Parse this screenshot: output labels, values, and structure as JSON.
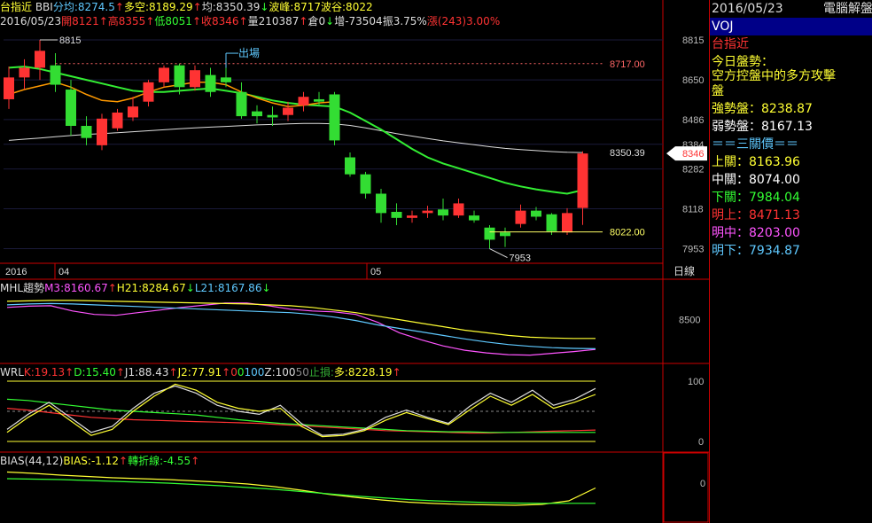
{
  "header": {
    "symbol": "台指近",
    "date": "2016/05/23",
    "stats": [
      {
        "text": "BBI",
        "color": "#dddddd"
      },
      {
        "text": "分均:8274.5",
        "color": "#5fc9ff"
      },
      {
        "text": "↑",
        "color": "#ff3333"
      },
      {
        "text": "多空:8189.29",
        "color": "#ffff33"
      },
      {
        "text": "↑",
        "color": "#ff3333"
      },
      {
        "text": "均:8350.39",
        "color": "#dddddd"
      },
      {
        "text": "↓",
        "color": "#33ff33"
      },
      {
        "text": "波峰:8717",
        "color": "#ffff33"
      },
      {
        "text": "波谷:8022",
        "color": "#ffff33"
      }
    ],
    "ohlc": [
      {
        "text": "2016/05/23",
        "color": "#dddddd"
      },
      {
        "text": "開8121",
        "color": "#ff3333"
      },
      {
        "text": "↑",
        "color": "#ff3333"
      },
      {
        "text": "高8355",
        "color": "#ff3333"
      },
      {
        "text": "↑",
        "color": "#ff3333"
      },
      {
        "text": "低8051",
        "color": "#33ff33"
      },
      {
        "text": "↑",
        "color": "#ff3333"
      },
      {
        "text": "收8346",
        "color": "#ff3333"
      },
      {
        "text": "↑",
        "color": "#ff3333"
      },
      {
        "text": "量210387",
        "color": "#dddddd"
      },
      {
        "text": "↑",
        "color": "#ff3333"
      },
      {
        "text": "倉0",
        "color": "#dddddd"
      },
      {
        "text": "↓",
        "color": "#33ff33"
      },
      {
        "text": "增-73504",
        "color": "#dddddd"
      },
      {
        "text": "振3.75%",
        "color": "#dddddd"
      },
      {
        "text": "漲(243)3.00%",
        "color": "#ff3333"
      }
    ]
  },
  "side_panel": {
    "date": "2016/05/23",
    "title": "電腦解盤",
    "code": "VOJ",
    "name": "台指近",
    "trend_label": "今日盤勢：",
    "trend_line1": "空方控盤中的多方攻擊",
    "trend_line2": "盤",
    "strong": "強勢盤：8238.87",
    "weak": "弱勢盤：8167.13",
    "three_title": "＝＝三關價＝＝",
    "up": "上關：8163.96",
    "mid": "中關：8074.00",
    "down": "下關：7984.04",
    "next_up": "明上：8471.13",
    "next_mid": "明中：8203.00",
    "next_down": "明下：7934.87"
  },
  "chart_data": [
    {
      "type": "candlestick",
      "ylim": [
        7900,
        8870
      ],
      "y_ticks": [
        "8815",
        "8650",
        "8486",
        "8384",
        "8282",
        "8118",
        "7953"
      ],
      "current_price_tag": "8346",
      "annotations": {
        "peak": "8815",
        "trough": "7953",
        "exit": "出場",
        "wave_peak": "8717.00",
        "wave_trough": "8022.00",
        "avg": "8350.39"
      },
      "x_labels": [
        "2016",
        "04",
        "05"
      ],
      "period": "日線",
      "candles": [
        {
          "o": 8570,
          "h": 8705,
          "l": 8530,
          "c": 8660
        },
        {
          "o": 8660,
          "h": 8735,
          "l": 8610,
          "c": 8700
        },
        {
          "o": 8700,
          "h": 8815,
          "l": 8650,
          "c": 8770
        },
        {
          "o": 8710,
          "h": 8760,
          "l": 8600,
          "c": 8630
        },
        {
          "o": 8610,
          "h": 8650,
          "l": 8420,
          "c": 8460
        },
        {
          "o": 8460,
          "h": 8500,
          "l": 8380,
          "c": 8410
        },
        {
          "o": 8380,
          "h": 8510,
          "l": 8360,
          "c": 8490
        },
        {
          "o": 8450,
          "h": 8530,
          "l": 8440,
          "c": 8515
        },
        {
          "o": 8495,
          "h": 8580,
          "l": 8480,
          "c": 8540
        },
        {
          "o": 8560,
          "h": 8650,
          "l": 8540,
          "c": 8640
        },
        {
          "o": 8640,
          "h": 8710,
          "l": 8620,
          "c": 8700
        },
        {
          "o": 8710,
          "h": 8717,
          "l": 8590,
          "c": 8620
        },
        {
          "o": 8620,
          "h": 8710,
          "l": 8605,
          "c": 8690
        },
        {
          "o": 8670,
          "h": 8700,
          "l": 8580,
          "c": 8600
        },
        {
          "o": 8660,
          "h": 8710,
          "l": 8620,
          "c": 8640
        },
        {
          "o": 8600,
          "h": 8640,
          "l": 8490,
          "c": 8500
        },
        {
          "o": 8520,
          "h": 8545,
          "l": 8470,
          "c": 8500
        },
        {
          "o": 8505,
          "h": 8540,
          "l": 8460,
          "c": 8495
        },
        {
          "o": 8505,
          "h": 8560,
          "l": 8480,
          "c": 8535
        },
        {
          "o": 8545,
          "h": 8600,
          "l": 8520,
          "c": 8580
        },
        {
          "o": 8570,
          "h": 8600,
          "l": 8540,
          "c": 8560
        },
        {
          "o": 8590,
          "h": 8600,
          "l": 8380,
          "c": 8400
        },
        {
          "o": 8330,
          "h": 8350,
          "l": 8250,
          "c": 8260
        },
        {
          "o": 8260,
          "h": 8270,
          "l": 8160,
          "c": 8180
        },
        {
          "o": 8180,
          "h": 8200,
          "l": 8060,
          "c": 8100
        },
        {
          "o": 8105,
          "h": 8140,
          "l": 8050,
          "c": 8080
        },
        {
          "o": 8080,
          "h": 8110,
          "l": 8060,
          "c": 8090
        },
        {
          "o": 8100,
          "h": 8130,
          "l": 8080,
          "c": 8110
        },
        {
          "o": 8115,
          "h": 8160,
          "l": 8070,
          "c": 8090
        },
        {
          "o": 8090,
          "h": 8160,
          "l": 8080,
          "c": 8140
        },
        {
          "o": 8090,
          "h": 8110,
          "l": 8060,
          "c": 8070
        },
        {
          "o": 8040,
          "h": 8050,
          "l": 7953,
          "c": 7990
        },
        {
          "o": 8020,
          "h": 8040,
          "l": 7960,
          "c": 8005
        },
        {
          "o": 8055,
          "h": 8135,
          "l": 8040,
          "c": 8110
        },
        {
          "o": 8110,
          "h": 8125,
          "l": 8070,
          "c": 8085
        },
        {
          "o": 8095,
          "h": 8100,
          "l": 8010,
          "c": 8025
        },
        {
          "o": 8020,
          "h": 8120,
          "l": 8010,
          "c": 8100
        },
        {
          "o": 8121,
          "h": 8355,
          "l": 8051,
          "c": 8346
        }
      ],
      "ma_short_color": "#ff9900",
      "ma_short": [
        8590,
        8610,
        8625,
        8640,
        8620,
        8590,
        8565,
        8560,
        8575,
        8600,
        8620,
        8630,
        8640,
        8640,
        8630,
        8600,
        8575,
        8555,
        8540,
        8545,
        8555,
        8560
      ],
      "ma_mid_color": "#33ee33",
      "ma_mid": [
        8700,
        8705,
        8695,
        8680,
        8665,
        8650,
        8635,
        8620,
        8605,
        8600,
        8600,
        8605,
        8610,
        8615,
        8605,
        8595,
        8580,
        8565,
        8555,
        8548,
        8544,
        8540,
        8515,
        8480,
        8445,
        8405,
        8365,
        8330,
        8305,
        8285,
        8265,
        8245,
        8225,
        8210,
        8198,
        8188,
        8180,
        8195
      ],
      "ma_long_color": "#dddddd",
      "ma_long": [
        8400,
        8405,
        8410,
        8415,
        8420,
        8425,
        8428,
        8432,
        8436,
        8440,
        8444,
        8448,
        8452,
        8455,
        8458,
        8461,
        8464,
        8466,
        8468,
        8470,
        8470,
        8468,
        8462,
        8452,
        8440,
        8428,
        8418,
        8408,
        8398,
        8390,
        8382,
        8374,
        8367,
        8362,
        8358,
        8354,
        8351,
        8350
      ]
    },
    {
      "type": "line",
      "name": "MHL趨勢",
      "labels": [
        {
          "text": "MHL趨勢",
          "color": "#dddddd"
        },
        {
          "text": "M3:8160.67",
          "color": "#ff55ff"
        },
        {
          "text": "↑",
          "color": "#ff3333"
        },
        {
          "text": "H21:8284.67",
          "color": "#ffff33"
        },
        {
          "text": "↓",
          "color": "#33ff33"
        },
        {
          "text": "L21:8167.86",
          "color": "#5fc9ff"
        },
        {
          "text": "↓",
          "color": "#33ff33"
        }
      ],
      "y_tick": "8500",
      "ylim": [
        8050,
        8760
      ],
      "series": [
        {
          "color": "#ff55ff",
          "values": [
            8640,
            8655,
            8660,
            8600,
            8560,
            8550,
            8580,
            8610,
            8640,
            8665,
            8690,
            8690,
            8660,
            8620,
            8600,
            8590,
            8560,
            8470,
            8350,
            8270,
            8200,
            8150,
            8120,
            8100,
            8095,
            8115,
            8135,
            8160
          ]
        },
        {
          "color": "#ffff33",
          "values": [
            8710,
            8715,
            8720,
            8720,
            8715,
            8710,
            8705,
            8700,
            8695,
            8690,
            8685,
            8680,
            8670,
            8660,
            8640,
            8610,
            8580,
            8540,
            8500,
            8460,
            8420,
            8380,
            8350,
            8320,
            8300,
            8290,
            8285,
            8285
          ]
        },
        {
          "color": "#5fc9ff",
          "values": [
            8670,
            8680,
            8685,
            8680,
            8670,
            8660,
            8650,
            8640,
            8630,
            8620,
            8610,
            8600,
            8590,
            8580,
            8560,
            8530,
            8490,
            8440,
            8400,
            8360,
            8320,
            8280,
            8245,
            8215,
            8195,
            8180,
            8172,
            8168
          ]
        }
      ]
    },
    {
      "type": "line",
      "name": "WRL",
      "labels": [
        {
          "text": "WRL",
          "color": "#dddddd"
        },
        {
          "text": "K:19.13",
          "color": "#ff3333"
        },
        {
          "text": "↑",
          "color": "#ff3333"
        },
        {
          "text": "D:15.40",
          "color": "#33ff33"
        },
        {
          "text": "↑",
          "color": "#ff3333"
        },
        {
          "text": "J1:88.43",
          "color": "#dddddd"
        },
        {
          "text": "↑",
          "color": "#ff3333"
        },
        {
          "text": "J2:77.91",
          "color": "#ffff33"
        },
        {
          "text": "↑",
          "color": "#ff3333"
        },
        {
          "text": "0",
          "color": "#ff3333"
        },
        {
          "text": "0",
          "color": "#33ff33"
        },
        {
          "text": "100",
          "color": "#5fc9ff"
        },
        {
          "text": "Z:100",
          "color": "#dddddd"
        },
        {
          "text": "50",
          "color": "#888888"
        },
        {
          "text": "止損:",
          "color": "#33aa33"
        },
        {
          "text": "多:8228.19",
          "color": "#ffff33"
        },
        {
          "text": "↑",
          "color": "#ff3333"
        }
      ],
      "y_ticks": [
        "100",
        "0"
      ],
      "ylim": [
        0,
        100
      ],
      "series": [
        {
          "color": "#ff3333",
          "values": [
            55,
            52,
            48,
            44,
            40,
            38,
            36,
            35,
            34,
            33,
            32,
            31,
            30,
            28,
            26,
            24,
            22,
            20,
            18,
            17,
            16,
            15,
            14,
            14,
            15,
            16,
            17,
            18,
            19
          ]
        },
        {
          "color": "#33ff33",
          "values": [
            70,
            68,
            64,
            60,
            56,
            52,
            50,
            48,
            46,
            44,
            40,
            36,
            33,
            30,
            28,
            26,
            24,
            22,
            20,
            18,
            17,
            16,
            16,
            15,
            15,
            15,
            15,
            15,
            15
          ]
        },
        {
          "color": "#dddddd",
          "values": [
            20,
            45,
            65,
            40,
            15,
            25,
            55,
            80,
            92,
            80,
            60,
            50,
            45,
            60,
            30,
            10,
            12,
            20,
            40,
            52,
            40,
            30,
            58,
            80,
            65,
            85,
            60,
            70,
            88
          ]
        },
        {
          "color": "#ffff33",
          "values": [
            15,
            40,
            60,
            35,
            10,
            20,
            50,
            75,
            95,
            85,
            65,
            55,
            50,
            55,
            25,
            8,
            10,
            18,
            35,
            48,
            38,
            28,
            52,
            75,
            60,
            78,
            55,
            65,
            78
          ]
        }
      ]
    },
    {
      "type": "line",
      "name": "BIAS(44,12)",
      "labels": [
        {
          "text": "BIAS(44,12)",
          "color": "#dddddd"
        },
        {
          "text": "BIAS:-1.12",
          "color": "#ffff33"
        },
        {
          "text": "↑",
          "color": "#ff3333"
        },
        {
          "text": "轉折線:-4.55",
          "color": "#33ff33"
        },
        {
          "text": "↑",
          "color": "#ff3333"
        }
      ],
      "y_tick": "0",
      "ylim": [
        -8,
        4
      ],
      "series": [
        {
          "color": "#ffff33",
          "values": [
            2.5,
            2.2,
            1.8,
            1.5,
            1.2,
            1.0,
            0.8,
            0.5,
            0.2,
            -0.2,
            -0.8,
            -1.6,
            -2.5,
            -3.2,
            -3.8,
            -4.3,
            -4.6,
            -4.8,
            -4.9,
            -5.0,
            -4.8,
            -4.0,
            -1.1
          ]
        },
        {
          "color": "#33ff33",
          "values": [
            1.0,
            0.9,
            0.8,
            0.6,
            0.4,
            0.2,
            0.0,
            -0.3,
            -0.6,
            -1.0,
            -1.4,
            -1.9,
            -2.4,
            -2.9,
            -3.3,
            -3.7,
            -4.0,
            -4.2,
            -4.4,
            -4.5,
            -4.55,
            -4.55,
            -4.55
          ]
        }
      ]
    }
  ]
}
